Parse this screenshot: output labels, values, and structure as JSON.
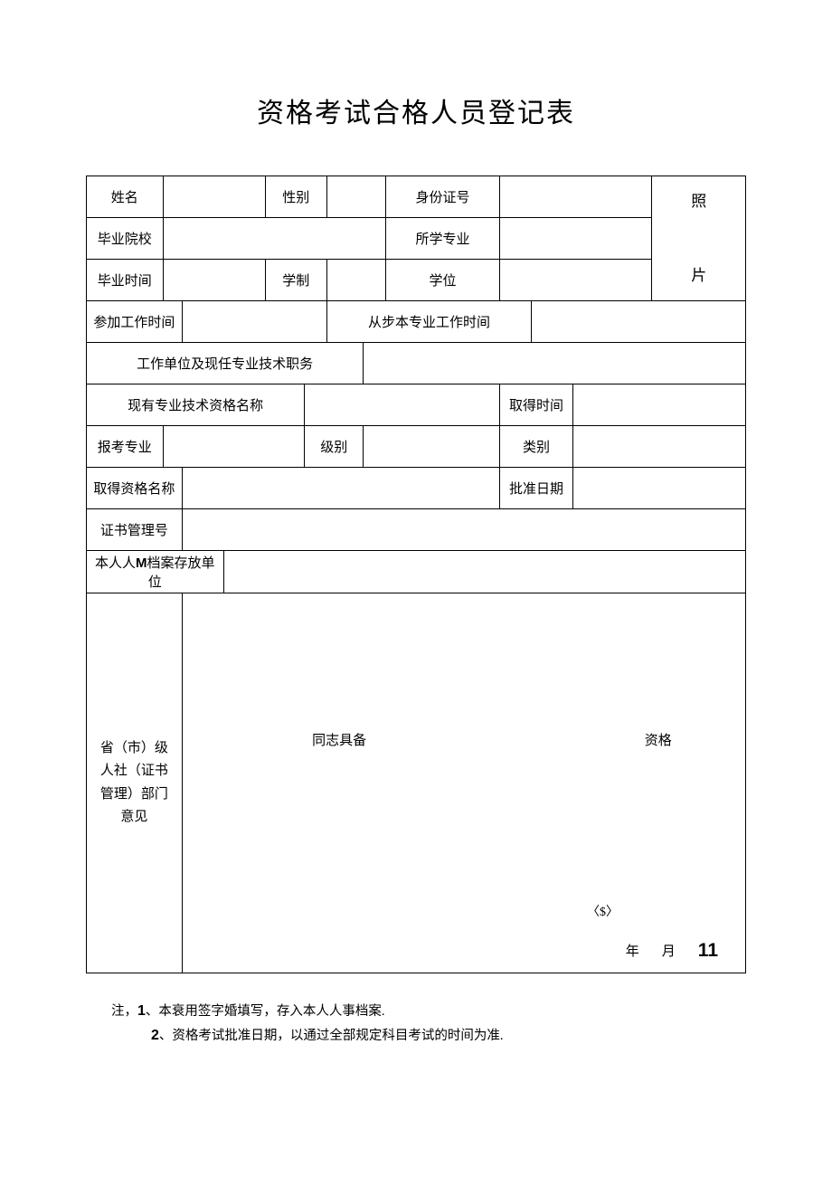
{
  "title": "资格考试合格人员登记表",
  "labels": {
    "name": "姓名",
    "gender": "性别",
    "id_number": "身份证号",
    "photo_top": "照",
    "photo_bottom": "片",
    "school": "毕业院校",
    "major": "所学专业",
    "grad_time": "毕业时间",
    "schooling": "学制",
    "degree": "学位",
    "work_start": "参加工作时间",
    "pro_work_start": "从步本专业工作时间",
    "work_unit_title": "工作单位及现任专业技术职务",
    "current_qual": "现有专业技术资格名称",
    "obtain_time": "取得时间",
    "exam_major": "报考专业",
    "level": "级别",
    "category": "类别",
    "obtained_qual": "取得资格名称",
    "approve_date": "批准日期",
    "cert_no": "证书管理号",
    "file_unit_prefix": "本人人",
    "file_unit_m": "M",
    "file_unit_suffix": "档案存放单位",
    "opinion_label": "省（市）级人社（证书管理）部门意见",
    "opinion_seg1": "同志具备",
    "opinion_seg2": "资格",
    "stamp": "〈$〉",
    "year": "年",
    "month": "月",
    "day_value": "11"
  },
  "notes": {
    "prefix": "注，",
    "n1_num": "1",
    "n1_text": "、本衰用签字婚填写，存入本人人事档案.",
    "n2_num": "2",
    "n2_text": "、资格考试批准日期，以通过全部规定科目考试的时间为准."
  }
}
